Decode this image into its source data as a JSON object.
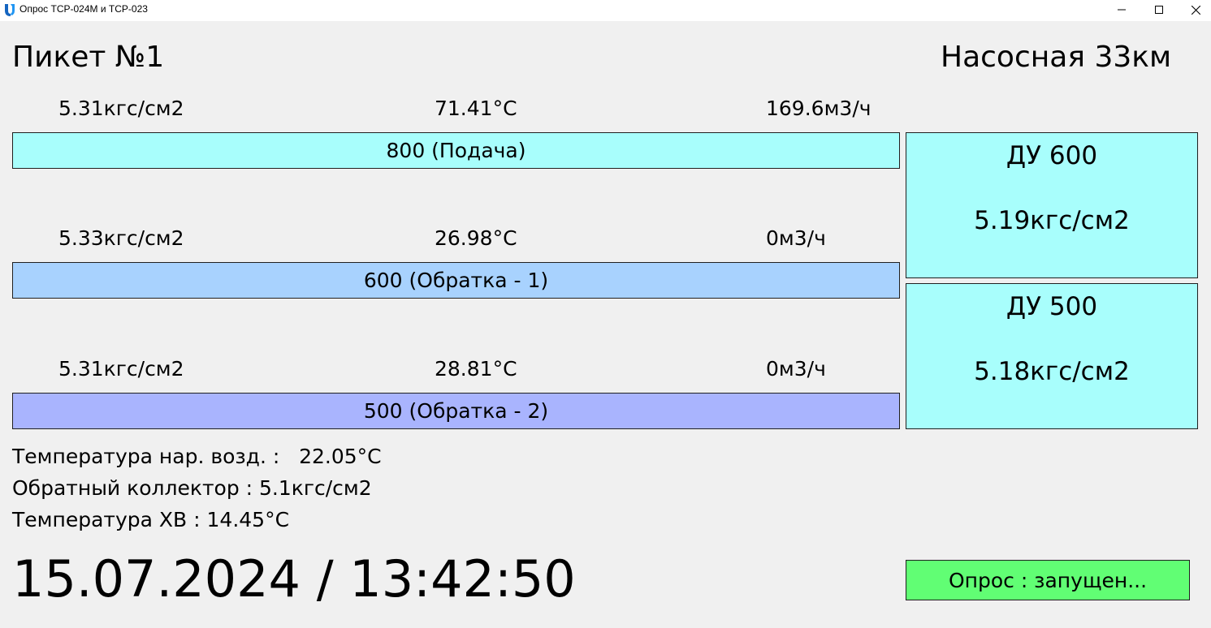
{
  "window": {
    "title": "Опрос ТСР-024М и ТСР-023",
    "icon": "app-logo-icon"
  },
  "header": {
    "piket": "Пикет №1",
    "station": "Насосная 33км"
  },
  "pipes": [
    {
      "pressure": "5.31кгс/см2",
      "temperature": "71.41°C",
      "flow": "169.6м3/ч",
      "label": "800 (Подача)",
      "color": "#a8fefc"
    },
    {
      "pressure": "5.33кгс/см2",
      "temperature": "26.98°C",
      "flow": "0м3/ч",
      "label": "600 (Обратка - 1)",
      "color": "#a8d2fe"
    },
    {
      "pressure": "5.31кгс/см2",
      "temperature": "28.81°C",
      "flow": "0м3/ч",
      "label": "500 (Обратка - 2)",
      "color": "#a9b4fe"
    }
  ],
  "du": [
    {
      "name": "ДУ 600",
      "value": "5.19кгс/см2"
    },
    {
      "name": "ДУ 500",
      "value": "5.18кгс/см2"
    }
  ],
  "info": {
    "outdoor_temp": "Температура нар. возд. :   22.05°C",
    "return_collector": "Обратный коллектор : 5.1кгс/см2",
    "cold_water_temp": "Температура ХВ : 14.45°C"
  },
  "datetime": "15.07.2024 / 13:42:50",
  "status": {
    "text": "Опрос : запущен...",
    "color": "#61fe74"
  }
}
